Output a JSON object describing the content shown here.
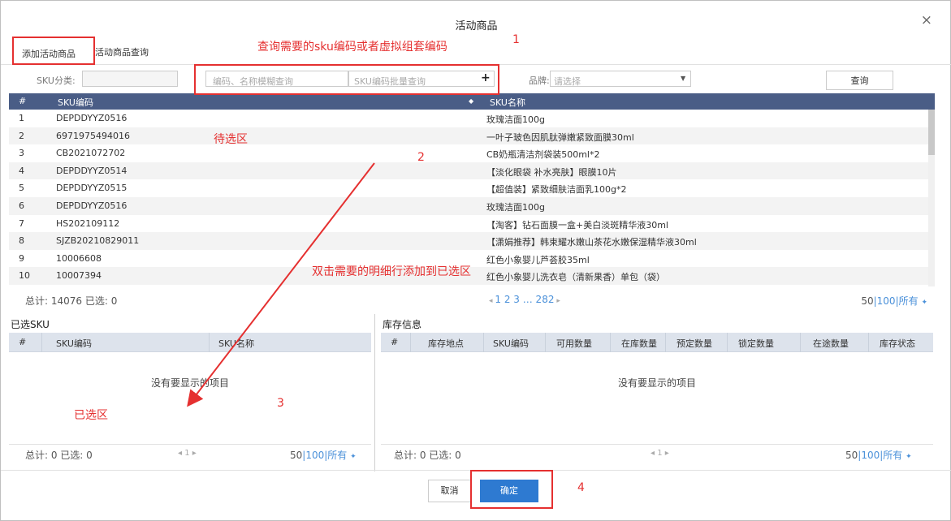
{
  "dialog": {
    "title": "活动商品",
    "close_glyph": "×"
  },
  "tabs": [
    {
      "label": "添加活动商品",
      "active": true
    },
    {
      "label": "活动商品查询",
      "active": false
    }
  ],
  "filter": {
    "sku_category_label": "SKU分类:",
    "fuzzy_placeholder": "编码、名称模糊查询",
    "batch_placeholder": "SKU编码批量查询",
    "add_glyph": "+",
    "brand_label": "品牌:",
    "brand_placeholder": "请选择",
    "query_button": "查询"
  },
  "candidate_table": {
    "columns": [
      "#",
      "SKU编码",
      "SKU名称"
    ],
    "rows": [
      {
        "no": "1",
        "code": "DEPDDYYZ0516",
        "name": "玫瑰洁面100g"
      },
      {
        "no": "2",
        "code": "6971975494016",
        "name": "一叶子玻色因肌肽弹嫩紧致面膜30ml"
      },
      {
        "no": "3",
        "code": "CB2021072702",
        "name": "CB奶瓶清洁剂袋装500ml*2"
      },
      {
        "no": "4",
        "code": "DEPDDYYZ0514",
        "name": "【淡化眼袋 补水亮肤】眼膜10片"
      },
      {
        "no": "5",
        "code": "DEPDDYYZ0515",
        "name": "【超值装】紧致细肤洁面乳100g*2"
      },
      {
        "no": "6",
        "code": "DEPDDYYZ0516",
        "name": "玫瑰洁面100g"
      },
      {
        "no": "7",
        "code": "HS202109112",
        "name": "【淘客】钻石面膜一盒+美白淡斑精华液30ml"
      },
      {
        "no": "8",
        "code": "SJZB20210829011",
        "name": "【潇娟推荐】韩束耀水嫩山茶花水嫩保湿精华液30ml"
      },
      {
        "no": "9",
        "code": "10006608",
        "name": "红色小象婴儿芦荟胶35ml"
      },
      {
        "no": "10",
        "code": "10007394",
        "name": "红色小象婴儿洗衣皂（清新果香）单包（袋）"
      }
    ]
  },
  "pager_top": {
    "total": "总计: 14076 已选: 0",
    "pages": "1 2 3 … 282",
    "sizes": [
      "50",
      "100",
      "所有"
    ]
  },
  "selected_panel": {
    "title": "已选SKU",
    "columns": [
      "#",
      "SKU编码",
      "SKU名称"
    ],
    "empty_text": "没有要显示的项目",
    "pager_total": "总计: 0 已选: 0",
    "pager_page": "1",
    "sizes": [
      "50",
      "100",
      "所有"
    ]
  },
  "stock_panel": {
    "title": "库存信息",
    "columns": [
      "#",
      "库存地点",
      "SKU编码",
      "可用数量",
      "在库数量",
      "预定数量",
      "锁定数量",
      "在途数量",
      "库存状态"
    ],
    "empty_text": "没有要显示的项目",
    "pager_total": "总计: 0 已选: 0",
    "pager_page": "1",
    "sizes": [
      "50",
      "100",
      "所有"
    ]
  },
  "footer": {
    "cancel": "取消",
    "confirm": "确定"
  },
  "annotations": {
    "query_hint": "查询需要的sku编码或者虚拟组套编码",
    "candidate_area": "待选区",
    "dblclick_hint": "双击需要的明细行添加到已选区",
    "selected_area": "已选区",
    "steps": [
      "1",
      "2",
      "3",
      "4"
    ]
  },
  "colors": {
    "header_bg": "#4a5d86",
    "accent": "#4a90d9",
    "confirm_bg": "#2e7ad1",
    "annotation": "#e53030"
  }
}
